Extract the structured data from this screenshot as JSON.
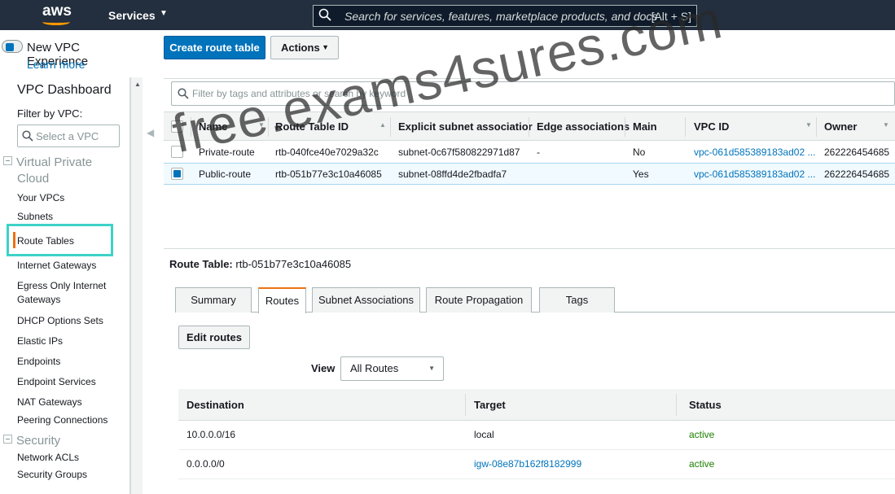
{
  "topbar": {
    "logo": "aws",
    "services_label": "Services",
    "search_placeholder": "Search for services, features, marketplace products, and docs",
    "search_shortcut": "[Alt + S]"
  },
  "experience": {
    "toggle_label": "New VPC Experience",
    "learn_more": "Learn more"
  },
  "sidebar": {
    "title": "VPC Dashboard",
    "filter_label": "Filter by VPC:",
    "filter_placeholder": "Select a VPC",
    "sections": [
      {
        "title_line1": "Virtual Private",
        "title_line2": "Cloud"
      },
      {
        "title": "Security"
      }
    ],
    "items": [
      "Your VPCs",
      "Subnets",
      "Route Tables",
      "Internet Gateways",
      "Egress Only Internet",
      "Gateways",
      "DHCP Options Sets",
      "Elastic IPs",
      "Endpoints",
      "Endpoint Services",
      "NAT Gateways",
      "Peering Connections",
      "Network ACLs",
      "Security Groups"
    ],
    "active_item": "Route Tables"
  },
  "toolbar": {
    "create_label": "Create route table",
    "actions_label": "Actions"
  },
  "grid": {
    "filter_placeholder": "Filter by tags and attributes or search by keyword",
    "columns": [
      "Name",
      "Route Table ID",
      "Explicit subnet associatior",
      "Edge associations",
      "Main",
      "VPC ID",
      "Owner"
    ],
    "rows": [
      {
        "name": "Private-route",
        "id": "rtb-040fce40e7029a32c",
        "subnet": "subnet-0c67f580822971d87",
        "edge": "-",
        "main": "No",
        "vpc": "vpc-061d585389183ad02 ...",
        "owner": "262226454685",
        "selected": false
      },
      {
        "name": "Public-route",
        "id": "rtb-051b77e3c10a46085",
        "subnet": "subnet-08ffd4de2fbadfa7",
        "edge": "",
        "main": "Yes",
        "vpc": "vpc-061d585389183ad02 ...",
        "owner": "262226454685",
        "selected": true
      }
    ]
  },
  "detail": {
    "label": "Route Table:",
    "value": "rtb-051b77e3c10a46085",
    "tabs": [
      "Summary",
      "Routes",
      "Subnet Associations",
      "Route Propagation",
      "Tags"
    ],
    "active_tab": "Routes",
    "edit_label": "Edit routes",
    "view_label": "View",
    "view_value": "All Routes"
  },
  "routes": {
    "columns": [
      "Destination",
      "Target",
      "Status"
    ],
    "rows": [
      {
        "destination": "10.0.0.0/16",
        "target": "local",
        "status": "active"
      },
      {
        "destination": "0.0.0.0/0",
        "target": "igw-08e87b162f8182999",
        "status": "active"
      }
    ]
  },
  "watermark": "free.exams4sures.com",
  "colors": {
    "topbar": "#232f3e",
    "primary": "#0073bb",
    "accent": "#ec7211",
    "highlight": "#3dd2c8",
    "status_ok": "#1d8102"
  }
}
